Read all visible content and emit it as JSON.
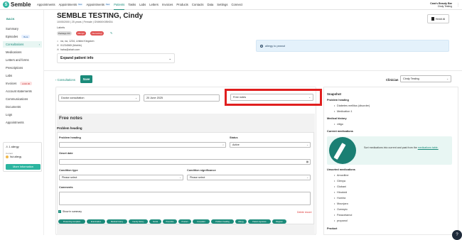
{
  "brand": {
    "name": "Semble"
  },
  "nav": {
    "items": [
      {
        "label": "Appointments",
        "badge": ""
      },
      {
        "label": "Appointments",
        "badge": "New"
      },
      {
        "label": "Appointments",
        "badge": "New"
      },
      {
        "label": "Patients",
        "badge": ""
      },
      {
        "label": "Tasks",
        "badge": ""
      },
      {
        "label": "Labs",
        "badge": ""
      },
      {
        "label": "Letters",
        "badge": ""
      },
      {
        "label": "Invoices",
        "badge": ""
      },
      {
        "label": "Products",
        "badge": ""
      },
      {
        "label": "Contacts",
        "badge": ""
      },
      {
        "label": "Data",
        "badge": ""
      },
      {
        "label": "Settings",
        "badge": ""
      },
      {
        "label": "Connect",
        "badge": ""
      }
    ],
    "active_index": 3
  },
  "user": {
    "location": "Cara's Beauty Bar",
    "name": "Cindy Testing"
  },
  "sidebar": {
    "back": "BACK",
    "items": [
      {
        "label": "Summary",
        "badge": ""
      },
      {
        "label": "Episodes",
        "badge": "Beta"
      },
      {
        "label": "Consultations",
        "badge": ""
      },
      {
        "label": "Medications",
        "badge": ""
      },
      {
        "label": "Letters and forms",
        "badge": ""
      },
      {
        "label": "Prescriptions",
        "badge": ""
      },
      {
        "label": "Labs",
        "badge": ""
      },
      {
        "label": "Invoices",
        "badge": "£410.00"
      },
      {
        "label": "Account statements",
        "badge": ""
      },
      {
        "label": "Communications",
        "badge": ""
      },
      {
        "label": "Documents",
        "badge": ""
      },
      {
        "label": "Logs",
        "badge": ""
      },
      {
        "label": "Appointments",
        "badge": ""
      }
    ],
    "allergy": {
      "title": "1 allergy",
      "current_label": "Current",
      "item": "Nut allergy",
      "button": "More Information"
    }
  },
  "patient": {
    "name": "SEMBLE TESTING, Cindy",
    "meta": "10/05/2000  |  25 years  |  Female  |  GNWMXXBKEA",
    "labels_heading": "Labels",
    "labels": [
      "Package 3/3",
      "Allergic",
      "Interesting!"
    ],
    "address": "na, na, 1234, United Kingdom",
    "phone": "01234565 (Mobile)",
    "email": "haha@ahah.com",
    "expand": "Expand patient info"
  },
  "heidi": {
    "label": "Heidi AI"
  },
  "alert": {
    "text": "allergy to peanut"
  },
  "toolbar": {
    "crumb": "Consultations",
    "save": "Save",
    "clinician_label": "Clinician",
    "clinician_value": "Cindy Testing"
  },
  "form": {
    "consult_type": "Doctor consultation",
    "date": "20 June 2025",
    "notes_type": "Free notes",
    "section_title": "Free notes",
    "problem_heading": "Problem heading",
    "field_problem_heading": "Problem heading",
    "field_status": "Status",
    "status_value": "Active",
    "field_onset": "Onset date",
    "field_condition_type": "Condition type",
    "condition_type_value": "Please select",
    "field_condition_sig": "Condition significance",
    "condition_sig_value": "Please select",
    "field_comments": "Comments",
    "show_summary": "Show in summary",
    "delete": "Delete record",
    "pills": [
      "Presenting complaint",
      "Examination",
      "Medical history",
      "Family history",
      "Social",
      "Prescribe",
      "Product",
      "Complaint",
      "Problem heading",
      "Allergy",
      "Patient signature",
      "Diagram"
    ]
  },
  "snapshot": {
    "title": "Snapshot",
    "problem_heading": "Problem heading",
    "problems": [
      "Diabetes mellitus (disorder)",
      "Medication 1"
    ],
    "medical_history": "Medical history",
    "history": [
      "vitigo"
    ],
    "current_meds": "Current medications",
    "meds_text": "Sort medications into current and past from the",
    "meds_link": "medications table.",
    "unsorted": "Unsorted medications",
    "unsorted_list": [
      "Amoxiline",
      "Glenya",
      "Giobani",
      "Hirudoid",
      "Humira",
      "Mounjaro",
      "Ozempic",
      "Paracetamol",
      "propanol"
    ],
    "product": "Product"
  }
}
